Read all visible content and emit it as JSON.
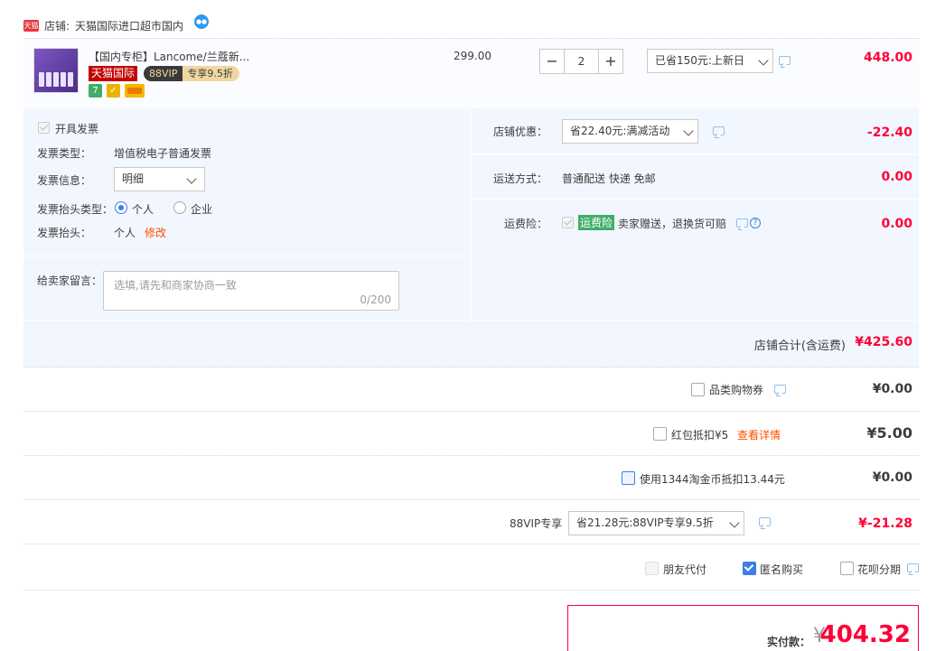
{
  "shop": {
    "badge": "天猫",
    "label": "店铺:",
    "name": "天猫国际进口超市国内"
  },
  "item": {
    "title": "【国内专柜】Lancome/兰蔻新...",
    "tag_tmall": "天猫国际",
    "tag_vip_a": "88VIP",
    "tag_vip_b": "专享9.5折",
    "svc": [
      "7",
      "✓",
      ""
    ],
    "unit_price": "299.00",
    "qty_minus": "−",
    "qty": "2",
    "qty_plus": "+",
    "promo_select": "已省150元:上新日",
    "subtotal": "448.00"
  },
  "invoice": {
    "open_label": "开具发票",
    "type_label": "发票类型：",
    "type_value": "增值税电子普通发票",
    "info_label": "发票信息：",
    "info_select": "明细",
    "header_type_label": "发票抬头类型：",
    "opt_personal": "个人",
    "opt_company": "企业",
    "header_label": "发票抬头：",
    "header_value": "个人",
    "modify": "修改"
  },
  "message": {
    "label": "给卖家留言：",
    "placeholder": "选填,请先和商家协商一致",
    "counter": "0/200"
  },
  "shop_discount": {
    "label": "店铺优惠：",
    "select": "省22.40元:满减活动",
    "amount": "-22.40"
  },
  "shipping": {
    "label": "运送方式：",
    "value": "普通配送 快递 免邮",
    "amount": "0.00"
  },
  "insurance": {
    "label": "运费险：",
    "tag": "运费险",
    "desc": "卖家赠送，退换货可赔",
    "amount": "0.00"
  },
  "shop_total": {
    "label": "店铺合计(含运费)",
    "amount": "¥425.60"
  },
  "summary": {
    "coupon": {
      "label": "品类购物券",
      "amount": "¥0.00"
    },
    "redpack": {
      "label": "红包抵扣¥5",
      "link": "查看详情",
      "amount": "¥5.00"
    },
    "coins": {
      "label": "使用1344淘金币抵扣13.44元",
      "amount": "¥0.00"
    },
    "vip": {
      "label": "88VIP专享",
      "select": "省21.28元:88VIP专享9.5折",
      "amount": "¥-21.28"
    },
    "options": {
      "friend_pay": "朋友代付",
      "anonymous": "匿名购买",
      "huabei": "花呗分期"
    }
  },
  "final": {
    "label": "实付款：",
    "currency": "¥",
    "amount": "404.32"
  },
  "colors": {
    "price_red": "#ff0036",
    "link_orange": "#ff5000",
    "accent_blue": "#3c7fe0",
    "tmall_red": "#c40000",
    "panel_bg": "#f2f7ff",
    "insurance_green": "#3fae67"
  }
}
